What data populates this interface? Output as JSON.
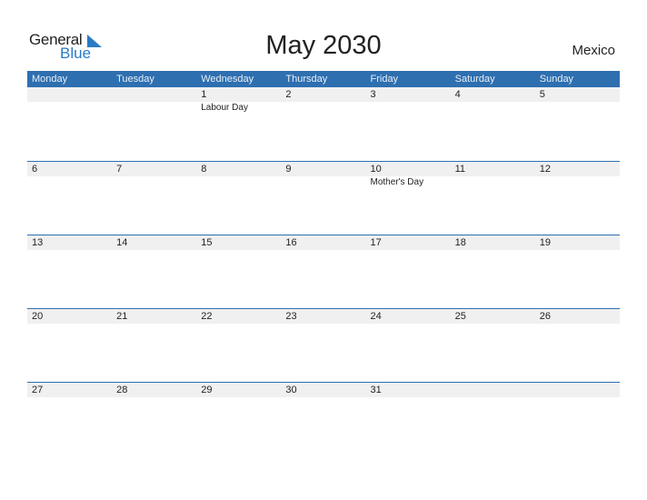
{
  "logo": {
    "general": "General",
    "blue": "Blue"
  },
  "title": "May 2030",
  "country": "Mexico",
  "colors": {
    "accent": "#2e6fb0",
    "strip": "#f0f0f0"
  },
  "weekdays": [
    "Monday",
    "Tuesday",
    "Wednesday",
    "Thursday",
    "Friday",
    "Saturday",
    "Sunday"
  ],
  "weeks": [
    {
      "days": [
        "",
        "",
        "1",
        "2",
        "3",
        "4",
        "5"
      ],
      "events": [
        "",
        "",
        "Labour Day",
        "",
        "",
        "",
        ""
      ]
    },
    {
      "days": [
        "6",
        "7",
        "8",
        "9",
        "10",
        "11",
        "12"
      ],
      "events": [
        "",
        "",
        "",
        "",
        "Mother's Day",
        "",
        ""
      ]
    },
    {
      "days": [
        "13",
        "14",
        "15",
        "16",
        "17",
        "18",
        "19"
      ],
      "events": [
        "",
        "",
        "",
        "",
        "",
        "",
        ""
      ]
    },
    {
      "days": [
        "20",
        "21",
        "22",
        "23",
        "24",
        "25",
        "26"
      ],
      "events": [
        "",
        "",
        "",
        "",
        "",
        "",
        ""
      ]
    },
    {
      "days": [
        "27",
        "28",
        "29",
        "30",
        "31",
        "",
        ""
      ],
      "events": [
        "",
        "",
        "",
        "",
        "",
        "",
        ""
      ]
    }
  ]
}
